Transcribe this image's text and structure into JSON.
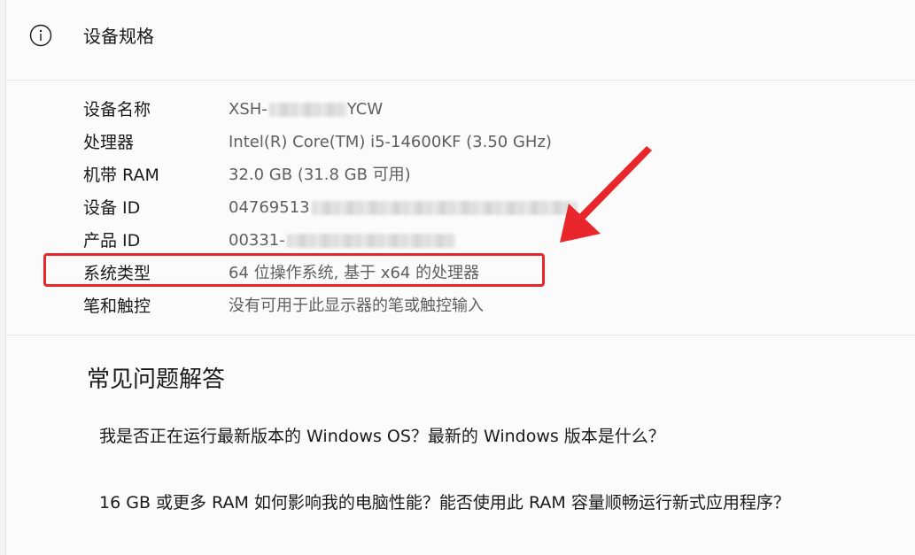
{
  "header": {
    "icon": "info-icon",
    "title": "设备规格"
  },
  "specs": [
    {
      "label": "设备名称",
      "value": "XSH-",
      "value_suffix": "YCW",
      "redacted": true
    },
    {
      "label": "处理器",
      "value": "Intel(R) Core(TM) i5-14600KF (3.50 GHz)",
      "redacted": false
    },
    {
      "label": "机带 RAM",
      "value": "32.0 GB (31.8 GB 可用)",
      "redacted": false
    },
    {
      "label": "设备 ID",
      "value": "04769513",
      "redacted": true
    },
    {
      "label": "产品 ID",
      "value": "00331-",
      "redacted": true
    },
    {
      "label": "系统类型",
      "value": "64 位操作系统, 基于 x64 的处理器",
      "redacted": false
    },
    {
      "label": "笔和触控",
      "value": "没有可用于此显示器的笔或触控输入",
      "redacted": false
    }
  ],
  "annotation": {
    "highlight_color": "#e8262b",
    "highlighted_row": "系统类型"
  },
  "faq": {
    "title": "常见问题解答",
    "items": [
      "我是否正在运行最新版本的 Windows OS？最新的 Windows 版本是什么？",
      "16 GB 或更多 RAM 如何影响我的电脑性能？能否使用此 RAM 容量顺畅运行新式应用程序？"
    ]
  }
}
